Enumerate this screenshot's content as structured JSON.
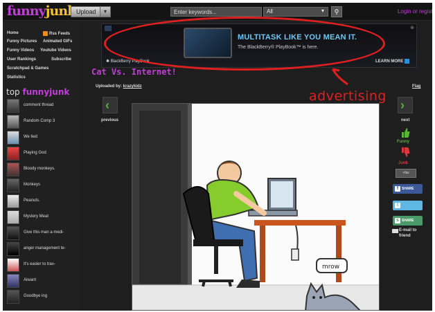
{
  "header": {
    "logo_part1": "funny",
    "logo_part2": "junk",
    "upload_label": "Upload",
    "search_placeholder": "Enter keywords...",
    "category_value": "All",
    "login_label": "Login or register"
  },
  "sidebar": {
    "links": [
      {
        "left": "Home",
        "right": "Rss Feeds"
      },
      {
        "left": "Funny Pictures",
        "right": "Animated GIFs"
      },
      {
        "left": "Funny Videos",
        "right": "Youtube Videos"
      },
      {
        "left": "User Rankings",
        "right": "Subscribe"
      },
      {
        "left": "Scratchpad & Games",
        "right": ""
      },
      {
        "left": "Statistics",
        "right": ""
      }
    ],
    "top_label_prefix": "top ",
    "top_label_brand": "funnyjunk",
    "top_items": [
      "comment thread",
      "Random Comp 3",
      "We lied",
      "Playing God",
      "Bloody monkeys.",
      "Monkeys",
      "Peanuts.",
      "Mystery Meat",
      "Give this man a medi-",
      "anger management te-",
      "It's easier to trav-",
      "Aiwant",
      "Goodbye ing"
    ]
  },
  "ad": {
    "headline": "MULTITASK LIKE YOU MEAN IT.",
    "subline": "The BlackBerry® PlayBook™ is here.",
    "brand": "BlackBerry PlayBook",
    "cta": "LEARN MORE",
    "annotation": "advertising"
  },
  "post": {
    "title": "Cat Vs. Internet!",
    "uploaded_prefix": "Uploaded by: ",
    "uploader": "krazykidz",
    "flag": "Flag",
    "previous": "previous",
    "next": "next",
    "cat_speech": "mrow"
  },
  "actions": {
    "funny": "Funny",
    "junk": "Junk",
    "fav": "+fav",
    "facebook": "SHARE",
    "twitter": "",
    "stumble": "SHARE",
    "email": "E-mail to friend"
  },
  "colors": {
    "brand_purple": "#c13fd8",
    "brand_yellow": "#f1c232",
    "annotation_red": "#e02020",
    "nav_green": "#59b339"
  }
}
